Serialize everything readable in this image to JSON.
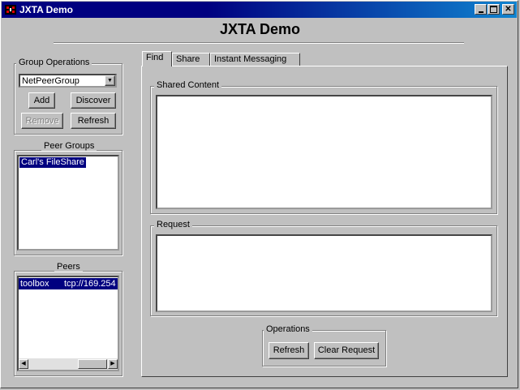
{
  "window": {
    "title": "JXTA Demo"
  },
  "header": {
    "title": "JXTA Demo"
  },
  "group_ops": {
    "legend": "Group Operations",
    "selected_group": "NetPeerGroup",
    "add_label": "Add",
    "discover_label": "Discover",
    "remove_label": "Remove",
    "refresh_label": "Refresh"
  },
  "peer_groups": {
    "legend": "Peer Groups",
    "items": [
      "Carl's FileShare"
    ]
  },
  "peers": {
    "legend": "Peers",
    "rows": [
      {
        "name": "toolbox",
        "address": "tcp://169.254"
      }
    ]
  },
  "tabs": [
    {
      "label": "Find"
    },
    {
      "label": "Share"
    },
    {
      "label": "Instant Messaging"
    }
  ],
  "find": {
    "shared_content_legend": "Shared Content",
    "request_legend": "Request",
    "operations_legend": "Operations",
    "refresh_label": "Refresh",
    "clear_label": "Clear Request"
  },
  "icons": {
    "app": "jxta-icon",
    "minimize": "minimize-icon",
    "maximize": "maximize-icon",
    "close": "close-icon",
    "dropdown": "chevron-down-icon",
    "scroll_left": "arrow-left-icon",
    "scroll_right": "arrow-right-icon"
  },
  "colors": {
    "titlebar": "#000080",
    "selection": "#000080",
    "face": "#c0c0c0"
  }
}
